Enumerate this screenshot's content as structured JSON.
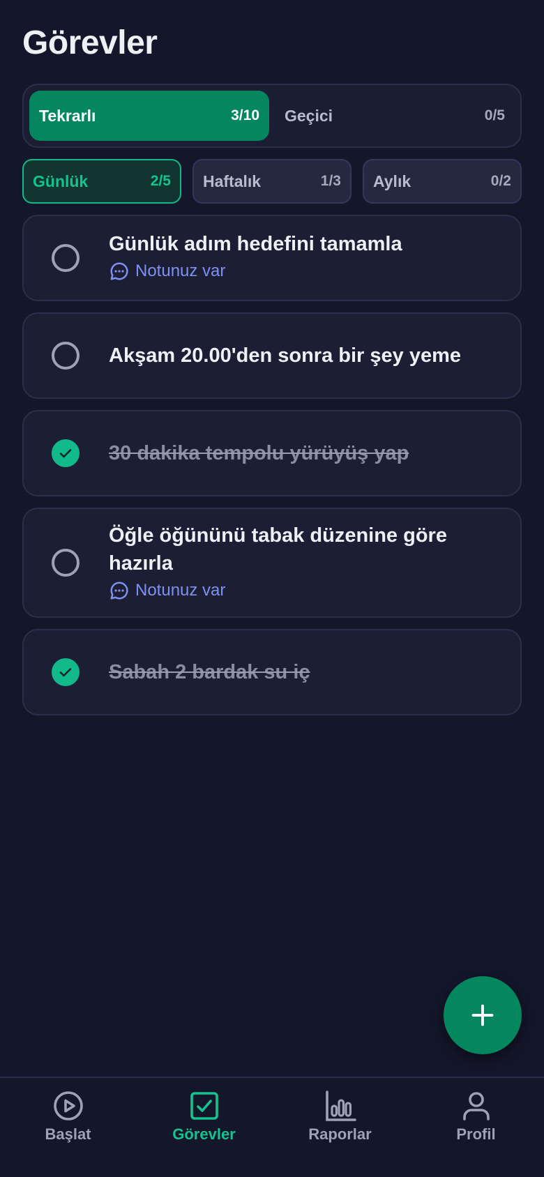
{
  "header": {
    "title": "Görevler"
  },
  "segment": [
    {
      "label": "Tekrarlı",
      "count": "3/10",
      "active": true
    },
    {
      "label": "Geçici",
      "count": "0/5",
      "active": false
    }
  ],
  "periods": [
    {
      "label": "Günlük",
      "count": "2/5",
      "active": true
    },
    {
      "label": "Haftalık",
      "count": "1/3",
      "active": false
    },
    {
      "label": "Aylık",
      "count": "0/2",
      "active": false
    }
  ],
  "tasks": [
    {
      "title": "Günlük adım hedefini tamamla",
      "note": "Notunuz var",
      "done": false
    },
    {
      "title": "Akşam 20.00'den sonra bir şey yeme",
      "done": false
    },
    {
      "title": "30 dakika tempolu yürüyüş yap",
      "done": true
    },
    {
      "title": "Öğle öğününü tabak düzenine göre hazırla",
      "note": "Notunuz var",
      "done": false
    },
    {
      "title": "Sabah 2 bardak su iç",
      "done": true
    }
  ],
  "fab": {
    "icon": "plus-icon"
  },
  "nav": [
    {
      "label": "Başlat",
      "icon": "play-circle-icon",
      "active": false
    },
    {
      "label": "Görevler",
      "icon": "checkbox-icon",
      "active": true
    },
    {
      "label": "Raporlar",
      "icon": "bar-chart-icon",
      "active": false
    },
    {
      "label": "Profil",
      "icon": "user-icon",
      "active": false
    }
  ],
  "colors": {
    "background": "#14162a",
    "accent": "#04865f",
    "accent_text": "#15c391",
    "note": "#7e91f3"
  }
}
